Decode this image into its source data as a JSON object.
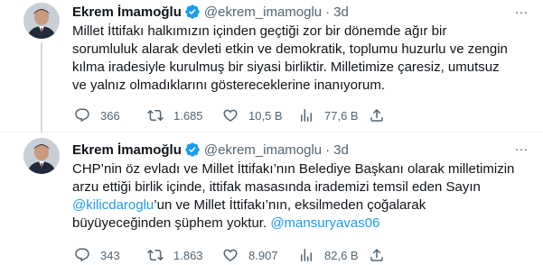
{
  "colors": {
    "accent": "#1d9bf0",
    "text_primary": "#0f1419",
    "text_secondary": "#536471",
    "divider": "#eff3f4"
  },
  "tweets": [
    {
      "author": {
        "name": "Ekrem İmamoğlu",
        "handle": "@ekrem_imamoglu",
        "separator": "·",
        "time": "3d",
        "verified_icon": "verified-badge-icon",
        "avatar_icon": "avatar-photo"
      },
      "more_label": "···",
      "text_lines": [
        "Millet İttifakı halkımızın içinden geçtiği zor bir dönemde ağır bir",
        "sorumluluk alarak devleti etkin ve demokratik, toplumu huzurlu ve zengin",
        "kılma iradesiyle kurulmuş bir siyasi birliktir. Milletimize çaresiz, umutsuz",
        "ve yalnız olmadıklarını göstereceklerine inanıyorum."
      ],
      "actions": {
        "reply": "366",
        "retweet": "1.685",
        "like": "10,5 B",
        "views": "77,6 B"
      }
    },
    {
      "author": {
        "name": "Ekrem İmamoğlu",
        "handle": "@ekrem_imamoglu",
        "separator": "·",
        "time": "3d",
        "verified_icon": "verified-badge-icon",
        "avatar_icon": "avatar-photo"
      },
      "more_label": "···",
      "text": {
        "line1": "CHP’nin öz evladı ve Millet İttifakı’nın Belediye Başkanı olarak milletimizin",
        "line2": "arzu ettiği birlik içinde, ittifak masasında irademizi temsil eden Sayın",
        "line3_mention": "@kilicdaroglu",
        "line3_rest": "’un ve Millet İttifakı’nın, eksilmeden çoğalarak",
        "line4_text": "büyüyeceğinden şüphem yoktur. ",
        "line4_mention": "@mansuryavas06"
      },
      "actions": {
        "reply": "343",
        "retweet": "1.863",
        "like": "8.907",
        "views": "82,6 B"
      }
    }
  ]
}
